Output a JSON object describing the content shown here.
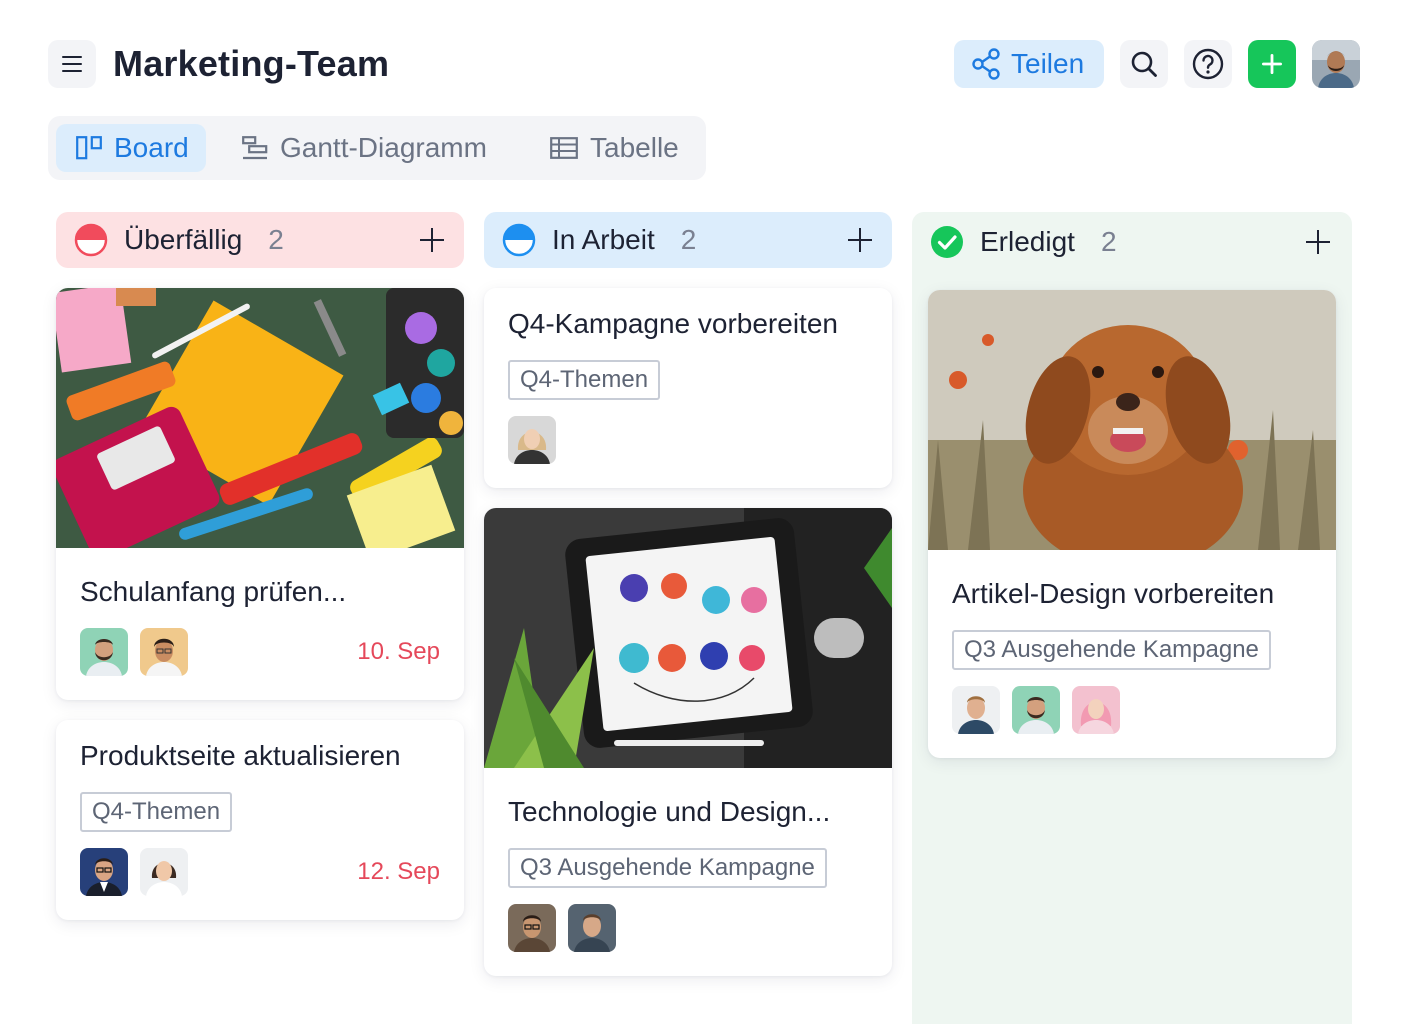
{
  "header": {
    "title": "Marketing-Team",
    "share_label": "Teilen",
    "menu_icon": "menu-icon",
    "search_icon": "search-icon",
    "help_icon": "help-icon",
    "add_icon": "plus-icon"
  },
  "tabs": [
    {
      "label": "Board",
      "icon": "board-icon",
      "active": true
    },
    {
      "label": "Gantt-Diagramm",
      "icon": "gantt-icon",
      "active": false
    },
    {
      "label": "Tabelle",
      "icon": "table-icon",
      "active": false
    }
  ],
  "colors": {
    "overdue": "#f14b5c",
    "in_progress": "#1d8ff0",
    "done": "#16c65a",
    "accent": "#1d7ae0",
    "due_date": "#e5485a"
  },
  "columns": [
    {
      "title": "Überfällig",
      "count": "2",
      "status_icon": "overdue-status-icon",
      "cards": [
        {
          "title": "Schulanfang prüfen...",
          "image": "school-supplies-photo",
          "due": "10. Sep",
          "assignees": 2
        },
        {
          "title": "Produktseite aktualisieren",
          "tag": "Q4-Themen",
          "due": "12. Sep",
          "assignees": 2
        }
      ]
    },
    {
      "title": "In Arbeit",
      "count": "2",
      "status_icon": "in-progress-status-icon",
      "cards": [
        {
          "title": "Q4-Kampagne vorbereiten",
          "tag": "Q4-Themen",
          "assignees": 1
        },
        {
          "title": "Technologie und Design...",
          "image": "tablet-sketch-photo",
          "tag": "Q3 Ausgehende Kampagne",
          "assignees": 2
        }
      ]
    },
    {
      "title": "Erledigt",
      "count": "2",
      "status_icon": "done-check-icon",
      "cards": [
        {
          "title": "Artikel-Design vorbereiten",
          "image": "dog-photo",
          "tag": "Q3 Ausgehende Kampagne",
          "assignees": 3
        }
      ]
    }
  ]
}
